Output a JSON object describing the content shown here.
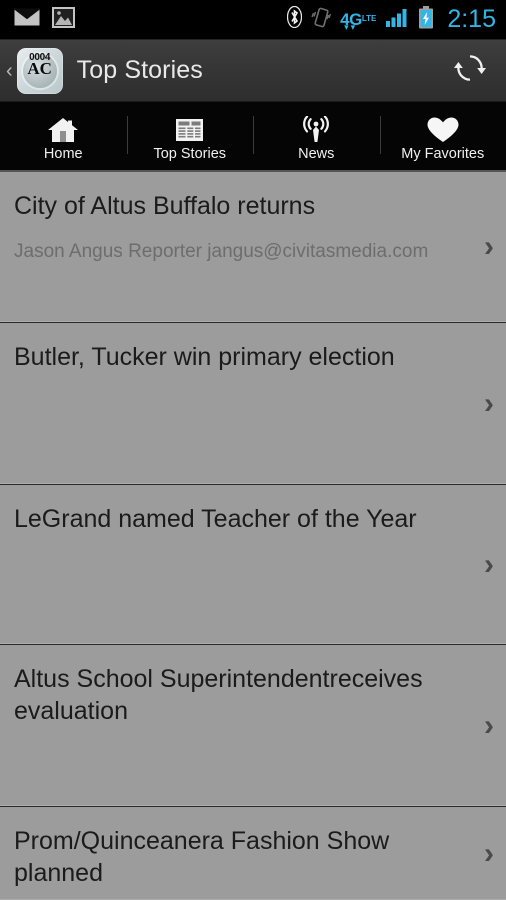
{
  "status_bar": {
    "left_icons": [
      {
        "name": "mail-icon",
        "glyph": "envelope"
      },
      {
        "name": "gallery-icon",
        "glyph": "picture"
      }
    ],
    "right_icons": [
      {
        "name": "bluetooth-icon",
        "glyph": "bluetooth"
      },
      {
        "name": "vibrate-icon",
        "glyph": "vibrate"
      },
      {
        "name": "signal-icon",
        "glyph": "signal-bars"
      },
      {
        "name": "battery-charging-icon",
        "glyph": "battery"
      }
    ],
    "network_label": "4G",
    "network_sub": "LTE",
    "network_arrows": "▾▾",
    "time": "2:15",
    "accent_color": "#33b5e5",
    "background_color": "#000000"
  },
  "action_bar": {
    "back_label": "‹",
    "app_icon_code": "0004",
    "app_icon_mark": "AC",
    "title": "Top Stories",
    "refresh_label": "refresh",
    "background_color": "#353535"
  },
  "tab_bar": {
    "background_color": "#050505",
    "tabs": [
      {
        "label": "Home",
        "icon": "home-icon",
        "selected": false
      },
      {
        "label": "Top Stories",
        "icon": "newspaper-icon",
        "selected": true
      },
      {
        "label": "News",
        "icon": "broadcast-tower-icon",
        "selected": false
      },
      {
        "label": "My Favorites",
        "icon": "heart-icon",
        "selected": false
      }
    ]
  },
  "list": {
    "background_color": "#9c9c9c",
    "chevron_glyph": "›",
    "items": [
      {
        "title": "City of Altus Buffalo returns",
        "subtitle": "Jason Angus Reporter jangus@civitasmedia.com"
      },
      {
        "title": "Butler, Tucker win primary election",
        "subtitle": ""
      },
      {
        "title": "LeGrand named Teacher of the Year",
        "subtitle": ""
      },
      {
        "title": "Altus School Superintendentreceives evaluation",
        "subtitle": ""
      },
      {
        "title": "Prom/Quinceanera Fashion Show planned",
        "subtitle": ""
      }
    ]
  }
}
